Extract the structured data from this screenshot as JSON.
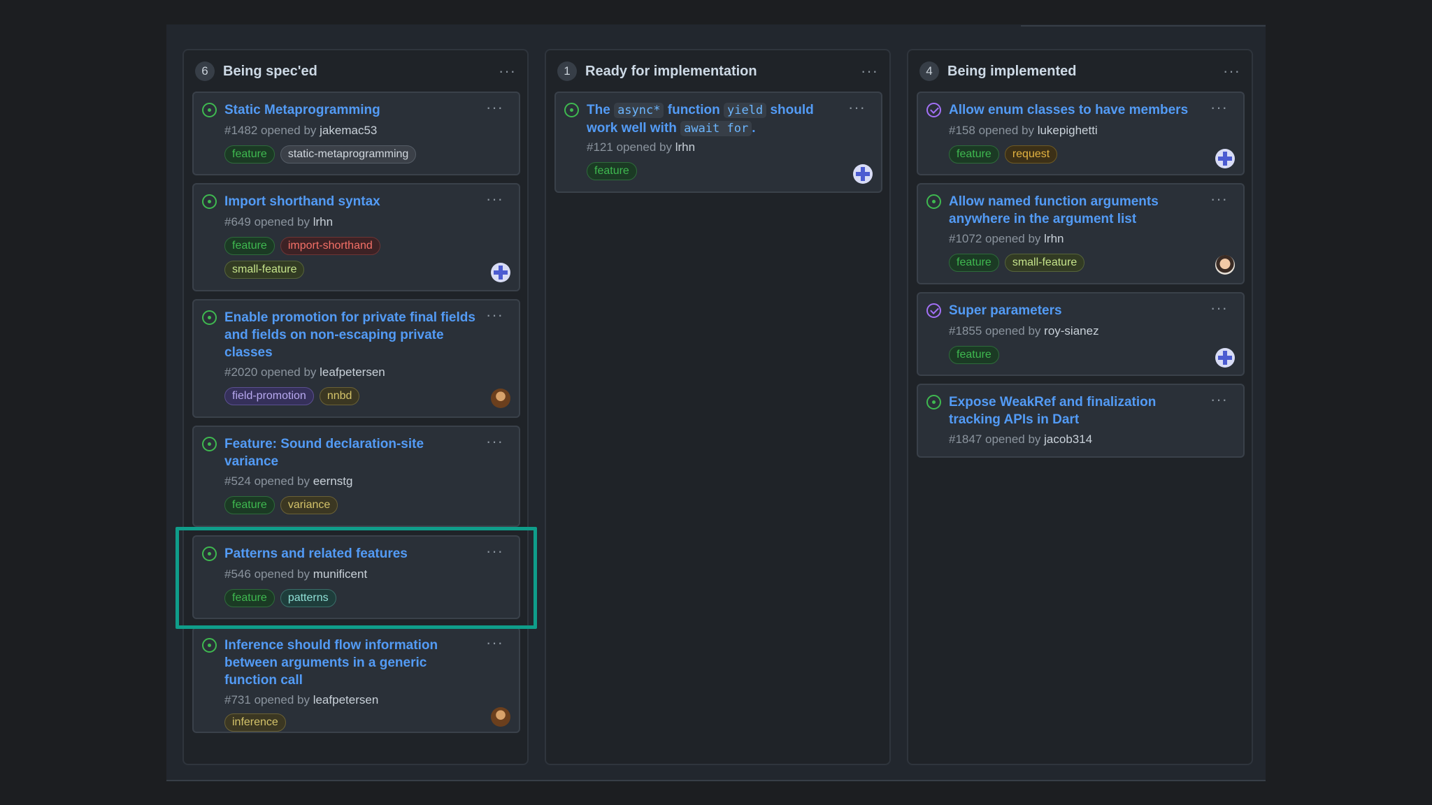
{
  "columns": [
    {
      "count": "6",
      "title": "Being spec'ed",
      "cards": [
        {
          "title": "Static Metaprogramming",
          "number": "#1482",
          "opened_by": "opened by",
          "author": "jakemac53",
          "labels": [
            "feature",
            "static-metaprogramming"
          ]
        },
        {
          "title": "Import shorthand syntax",
          "number": "#649",
          "opened_by": "opened by",
          "author": "lrhn",
          "labels": [
            "feature",
            "import-shorthand",
            "small-feature"
          ]
        },
        {
          "title": "Enable promotion for private final fields and fields on non-escaping private classes",
          "number": "#2020",
          "opened_by": "opened by",
          "author": "leafpetersen",
          "labels": [
            "field-promotion",
            "nnbd"
          ]
        },
        {
          "title": "Feature: Sound declaration-site variance",
          "number": "#524",
          "opened_by": "opened by",
          "author": "eernstg",
          "labels": [
            "feature",
            "variance"
          ]
        },
        {
          "title": "Patterns and related features",
          "number": "#546",
          "opened_by": "opened by",
          "author": "munificent",
          "labels": [
            "feature",
            "patterns"
          ]
        },
        {
          "title": "Inference should flow information between arguments in a generic function call",
          "number": "#731",
          "opened_by": "opened by",
          "author": "leafpetersen",
          "labels": [
            "inference"
          ]
        }
      ]
    },
    {
      "count": "1",
      "title": "Ready for implementation",
      "cards": [
        {
          "title_parts": [
            "The",
            "async*",
            "function",
            "yield",
            "should work well with",
            "await for",
            "."
          ],
          "number": "#121",
          "opened_by": "opened by",
          "author": "lrhn",
          "labels": [
            "feature"
          ]
        }
      ]
    },
    {
      "count": "4",
      "title": "Being implemented",
      "cards": [
        {
          "title": "Allow enum classes to have members",
          "number": "#158",
          "opened_by": "opened by",
          "author": "lukepighetti",
          "labels": [
            "feature",
            "request"
          ]
        },
        {
          "title": "Allow named function arguments anywhere in the argument list",
          "number": "#1072",
          "opened_by": "opened by",
          "author": "lrhn",
          "labels": [
            "feature",
            "small-feature"
          ]
        },
        {
          "title": "Super parameters",
          "number": "#1855",
          "opened_by": "opened by",
          "author": "roy-sianez",
          "labels": [
            "feature"
          ]
        },
        {
          "title": "Expose WeakRef and finalization tracking APIs in Dart",
          "number": "#1847",
          "opened_by": "opened by",
          "author": "jacob314",
          "labels": []
        }
      ]
    }
  ],
  "more_icon": "···",
  "colors": {
    "accent_link": "#539bf5",
    "open_icon": "#3fb950",
    "done_icon": "#a371f7",
    "highlight": "#0f9d8a"
  }
}
